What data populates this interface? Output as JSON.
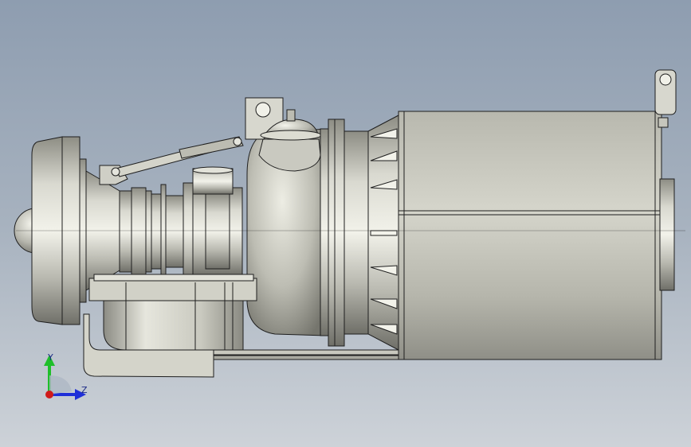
{
  "viewport": {
    "background_top": "#8e9db0",
    "background_bottom": "#cdd2d8"
  },
  "triad": {
    "y_label": "Y",
    "z_label": "Z",
    "y_color": "#1fbf2a",
    "z_color": "#1f2fd8",
    "x_color": "#d01a1a"
  },
  "model": {
    "name_icon": "pump-motor-assembly-icon",
    "edge_color": "#1e1e1e",
    "body_color": "#b8b8ac"
  }
}
